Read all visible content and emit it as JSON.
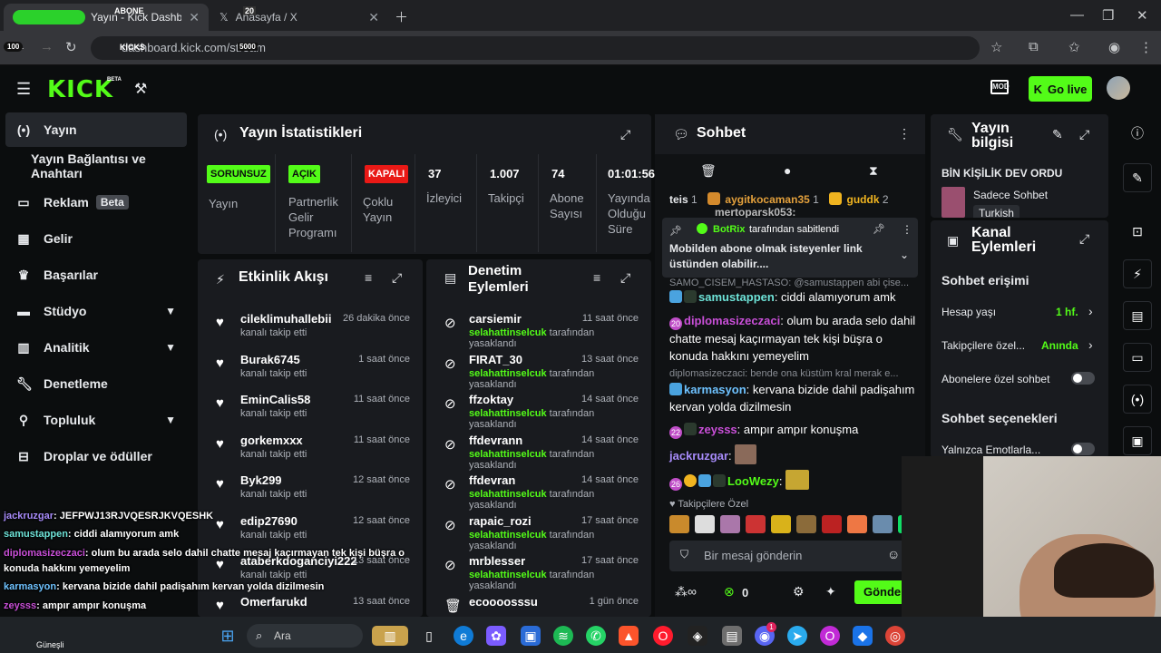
{
  "browser": {
    "tab1": "Yayın - Kick Dashboard",
    "tab2": "Anasayfa / X",
    "url": "dashboard.kick.com/stream",
    "overlay_abone_label": "ABONE",
    "overlay_abone_count": "20",
    "overlay_kicks": "KICKS",
    "overlay_count": "5000",
    "overlay_left": "100"
  },
  "header": {
    "logo": "KICK",
    "beta": "BETA",
    "go_live": "Go live"
  },
  "sidebar": {
    "items": [
      {
        "label": "Yayın"
      },
      {
        "label": "Yayın Bağlantısı ve Anahtarı"
      },
      {
        "label": "Reklam",
        "badge": "Beta"
      },
      {
        "label": "Gelir"
      },
      {
        "label": "Başarılar"
      },
      {
        "label": "Stüdyo"
      },
      {
        "label": "Analitik"
      },
      {
        "label": "Denetleme"
      },
      {
        "label": "Topluluk"
      },
      {
        "label": "Droplar ve ödüller"
      }
    ]
  },
  "stats": {
    "title": "Yayın İstatistikleri",
    "items": [
      {
        "badge": "SORUNSUZ",
        "label": "Yayın"
      },
      {
        "badge": "AÇIK",
        "label": "Partnerlik Gelir Programı"
      },
      {
        "badge": "KAPALI",
        "label": "Çoklu Yayın"
      },
      {
        "value": "37",
        "label": "İzleyici"
      },
      {
        "value": "1.007",
        "label": "Takipçi"
      },
      {
        "value": "74",
        "label": "Abone Sayısı"
      },
      {
        "value": "01:01:56",
        "label": "Yayında Olduğu Süre"
      }
    ]
  },
  "activity": {
    "title": "Etkinlik Akışı",
    "items": [
      {
        "name": "cileklimuhallebii",
        "sub": "kanalı takip etti",
        "time": "26 dakika önce"
      },
      {
        "name": "Burak6745",
        "sub": "kanalı takip etti",
        "time": "1 saat önce"
      },
      {
        "name": "EminCalis58",
        "sub": "kanalı takip etti",
        "time": "11 saat önce"
      },
      {
        "name": "gorkemxxx",
        "sub": "kanalı takip etti",
        "time": "11 saat önce"
      },
      {
        "name": "Byk299",
        "sub": "kanalı takip etti",
        "time": "12 saat önce"
      },
      {
        "name": "edip27690",
        "sub": "kanalı takip etti",
        "time": "12 saat önce"
      },
      {
        "name": "ataberkdoganciyi222",
        "sub": "kanalı takip etti",
        "time": "13 saat önce"
      },
      {
        "name": "Omerfarukd",
        "sub": "",
        "time": "13 saat önce"
      }
    ]
  },
  "moderation": {
    "title": "Denetim Eylemleri",
    "by": "selahattinselcuk",
    "action": "tarafından yasaklandı",
    "items": [
      {
        "name": "carsiemir",
        "time": "11 saat önce"
      },
      {
        "name": "FIRAT_30",
        "time": "13 saat önce"
      },
      {
        "name": "ffzoktay",
        "time": "14 saat önce"
      },
      {
        "name": "ffdevrann",
        "time": "14 saat önce"
      },
      {
        "name": "ffdevran",
        "time": "14 saat önce"
      },
      {
        "name": "rapaic_rozi",
        "time": "17 saat önce"
      },
      {
        "name": "mrblesser",
        "time": "17 saat önce"
      },
      {
        "name": "ecoooosssu",
        "time": "1 gün önce"
      }
    ]
  },
  "chat": {
    "title": "Sohbet",
    "top_users": [
      {
        "name": "teis",
        "count": "1"
      },
      {
        "name": "aygitkocaman35",
        "count": "1"
      },
      {
        "name": "guddk",
        "count": "2"
      }
    ],
    "pinned_by": "BotRix",
    "pinned_label": "tarafından sabitlendi",
    "pinned_text": "Mobilden abone olmak isteyenler link üstünden olabilir....",
    "partial_user": "mertoparsk053:",
    "reply1": "SAMO_CISEM_HASTASO: @samustappen abi çise...",
    "reply2": "diplomasizeczaci: bende ona küstüm kral merak e...",
    "messages": [
      {
        "badge": "",
        "user": "samustappen",
        "text": "ciddi alamıyorum amk"
      },
      {
        "badge": "20",
        "user": "diplomasizeczaci",
        "text": "olum bu arada selo dahil chatte mesaj kaçırmayan tek kişi büşra o konuda hakkını yemeyelim"
      },
      {
        "badge": "",
        "user": "karmasyon",
        "text": "kervana bizide dahil padişahım kervan yolda dizilmesin"
      },
      {
        "badge": "22",
        "user": "zeysss",
        "text": "ampır ampır konuşma"
      },
      {
        "badge": "",
        "user": "jackruzgar",
        "text": ""
      },
      {
        "badge": "26",
        "user": "LooWezy",
        "text": ""
      }
    ],
    "followers_only": "Takipçilere Özel",
    "input_placeholder": "Bir mesaj gönderin",
    "kicks_count": "0",
    "send": "Gönder"
  },
  "stream_info": {
    "title": "Yayın bilgisi",
    "stream_title": "BİN KİŞİLİK DEV ORDU",
    "category": "Sadece Sohbet",
    "language": "Turkish"
  },
  "channel_actions": {
    "title": "Kanal Eylemleri",
    "chat_access": "Sohbet erişimi",
    "account_age_label": "Hesap yaşı",
    "account_age_value": "1 hf.",
    "followers_label": "Takipçilere özel...",
    "followers_value": "Anında",
    "subs_label": "Abonelere özel sohbet",
    "chat_options": "Sohbet seçenekleri",
    "emotes_only": "Yalnızca Emotlarla..."
  },
  "overlay_chat": [
    {
      "user": "jackruzgar",
      "text": "JEFPWJ13RJVQESRJKVQESHK"
    },
    {
      "user": "samustappen",
      "text": "ciddi alamıyorum amk"
    },
    {
      "user": "diplomasizeczaci",
      "text": "olum bu arada selo dahil chatte mesaj kaçırmayan tek kişi büşra o"
    },
    {
      "user": "",
      "text": "konuda hakkını yemeyelim"
    },
    {
      "user": "karmasyon",
      "text": "kervana bizide dahil padişahım kervan yolda dizilmesin"
    },
    {
      "user": "zeysss",
      "text": "ampır ampır konuşma"
    },
    {
      "user": "jackruzgar",
      "text": ""
    },
    {
      "user": "LooWezy",
      "text": ""
    }
  ],
  "taskbar": {
    "search": "Ara",
    "weather": "Güneşli",
    "notif_count": "1"
  },
  "colors": {
    "accent": "#53fc18",
    "panel": "#191b1f",
    "bg": "#0b0d0e",
    "danger": "#e91916"
  }
}
